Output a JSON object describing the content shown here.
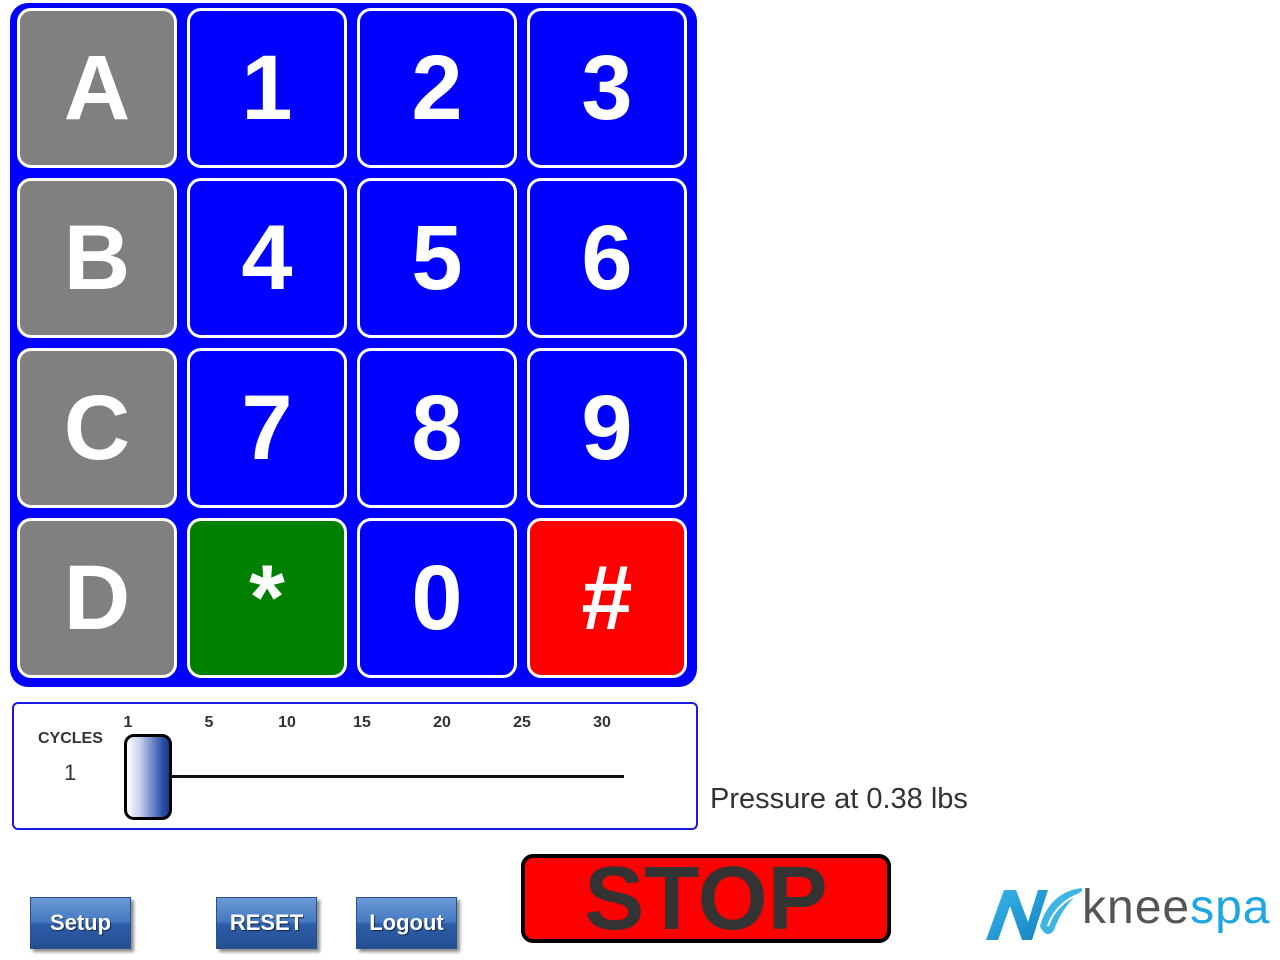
{
  "keypad": {
    "keys": [
      {
        "label": "A",
        "color": "gray"
      },
      {
        "label": "1",
        "color": "blue"
      },
      {
        "label": "2",
        "color": "blue"
      },
      {
        "label": "3",
        "color": "blue"
      },
      {
        "label": "B",
        "color": "gray"
      },
      {
        "label": "4",
        "color": "blue"
      },
      {
        "label": "5",
        "color": "blue"
      },
      {
        "label": "6",
        "color": "blue"
      },
      {
        "label": "C",
        "color": "gray"
      },
      {
        "label": "7",
        "color": "blue"
      },
      {
        "label": "8",
        "color": "blue"
      },
      {
        "label": "9",
        "color": "blue"
      },
      {
        "label": "D",
        "color": "gray"
      },
      {
        "label": "*",
        "color": "green"
      },
      {
        "label": "0",
        "color": "blue"
      },
      {
        "label": "#",
        "color": "red"
      }
    ],
    "colors": {
      "blue": "#0000ff",
      "gray": "#808080",
      "green": "#008000",
      "red": "#ff0000"
    }
  },
  "cycles": {
    "label": "CYCLES",
    "value": "1",
    "ticks": [
      "1",
      "5",
      "10",
      "15",
      "20",
      "25",
      "30"
    ]
  },
  "pressure_text": "Pressure at 0.38 lbs",
  "buttons": {
    "setup": "Setup",
    "reset": "RESET",
    "logout": "Logout",
    "stop": "STOP"
  },
  "logo": {
    "name_part1": "knee",
    "name_part2": "spa",
    "icon": "kneespa-logo-icon",
    "accent_color": "#1ea7e0"
  }
}
